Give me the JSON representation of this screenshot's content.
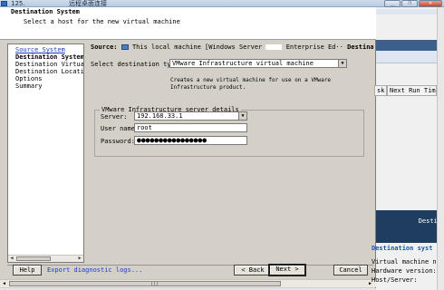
{
  "window": {
    "title_number": "125.",
    "title_text": "远程桌面连接",
    "minimize_glyph": "_",
    "restore_glyph": "❐",
    "close_glyph": "✕"
  },
  "wizard": {
    "header_title": "Destination System",
    "header_subtitle": "Select a host for the new virtual machine",
    "nav_items": [
      "Source System",
      "Destination System",
      "Destination Virtual Ma",
      "Destination Location",
      "Options",
      "Summary"
    ],
    "source_label": "Source:",
    "source_value": "This local machine [Windows Server",
    "source_edition": "Enterprise Ed",
    "destination_label": "Destination:",
    "destination_value": "n",
    "select_destination_label": "Select destination type:",
    "select_destination_value": "VMware Infrastructure virtual machine",
    "select_destination_description": "Creates a new virtual machine for use on a VMware Infrastructure product.",
    "group_title": "VMware Infrastructure server details",
    "server_label": "Server:",
    "server_value": "192.168.33.1",
    "username_label": "User name:",
    "username_value": "root",
    "password_label": "Password:",
    "password_value": "●●●●●●●●●●●●●●●●",
    "help_button": "Help",
    "export_link": "Export diagnostic logs...",
    "back_button": "< Back",
    "next_button": "Next >",
    "cancel_button": "Cancel"
  },
  "background_window": {
    "col_1": "sk",
    "col_2": "Next Run Time",
    "dark_panel_text": "Destin",
    "info_title": "Destination syst",
    "info_line_1": "Virtual machine nam",
    "info_line_2": "Hardware version:",
    "info_line_3": "Host/Server:"
  },
  "colors": {
    "dialog_face": "#d4d0c8",
    "link_blue": "#1a3cc8",
    "bg_dark_panel": "#1f3d60"
  }
}
